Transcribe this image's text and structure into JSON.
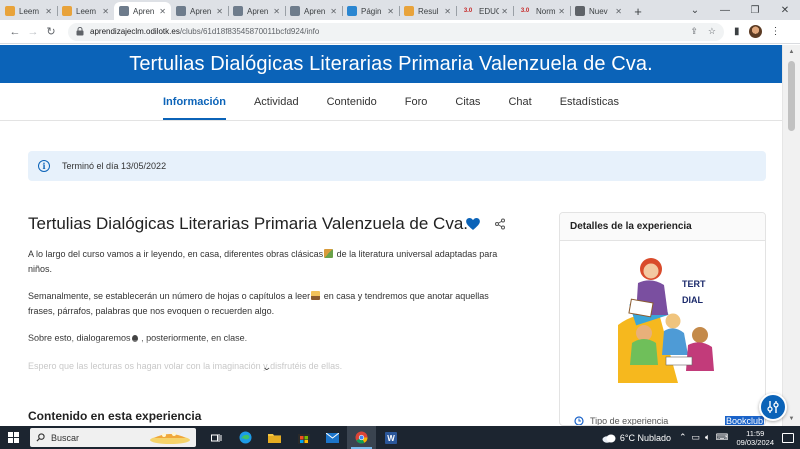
{
  "browser": {
    "tabs": [
      {
        "title": "Leem",
        "fav": "#e8a33b",
        "fav_text": ""
      },
      {
        "title": "Leem",
        "fav": "#e8a33b",
        "fav_text": ""
      },
      {
        "title": "Apren",
        "fav": "#6e7c8c",
        "fav_text": "",
        "active": true
      },
      {
        "title": "Apren",
        "fav": "#6e7c8c",
        "fav_text": ""
      },
      {
        "title": "Apren",
        "fav": "#6e7c8c",
        "fav_text": ""
      },
      {
        "title": "Apren",
        "fav": "#6e7c8c",
        "fav_text": ""
      },
      {
        "title": "Págin",
        "fav": "#2a86d1",
        "fav_text": ""
      },
      {
        "title": "Resul",
        "fav": "#e8a33b",
        "fav_text": ""
      },
      {
        "title": "EDUC",
        "fav": "#c62828",
        "fav_text": "3.0"
      },
      {
        "title": "Norm",
        "fav": "#c62828",
        "fav_text": "3.0"
      },
      {
        "title": "Nuev",
        "fav": "#5f6368",
        "fav_text": ""
      }
    ],
    "url_host": "aprendizajeclm.odilotk.es",
    "url_path": "/clubs/61d18f83545870011bcfd924/info"
  },
  "site": {
    "header_title": "Tertulias Dialógicas Literarias Primaria Valenzuela de Cva.",
    "nav": [
      "Información",
      "Actividad",
      "Contenido",
      "Foro",
      "Citas",
      "Chat",
      "Estadísticas"
    ],
    "nav_active": 0
  },
  "alert": {
    "text": "Terminó el día 13/05/2022"
  },
  "experience": {
    "title": "Tertulias Dialógicas Literarias Primaria Valenzuela de Cva.",
    "p1_a": "A lo largo del curso vamos a ir leyendo, en casa, diferentes obras clásicas",
    "p1_b": " de la literatura universal adaptadas para niños.",
    "p2_a": "Semanalmente, se establecerán un número de hojas o capítulos a leer",
    "p2_b": " en casa y tendremos que anotar aquellas frases, párrafos, palabras que nos evoquen o recuerden algo.",
    "p3_a": "Sobre esto,  dialogaremos",
    "p3_b": " , posteriormente, en clase.",
    "p4": "Espero que las lecturas os hagan volar con la imaginación y disfrutéis de ellas.",
    "section_title": "Contenido en esta experiencia"
  },
  "details": {
    "title": "Detalles de la experiencia",
    "image_text_1": "TERT",
    "image_text_2": "DIAL",
    "type_label": "Tipo de experiencia",
    "type_value": "Bookclub"
  },
  "taskbar": {
    "search": "Buscar",
    "weather": "6°C  Nublado",
    "time": "11:59",
    "date": "09/03/2024"
  },
  "colors": {
    "brand": "#0b63b8",
    "alert_bg": "#e7f1fb"
  }
}
